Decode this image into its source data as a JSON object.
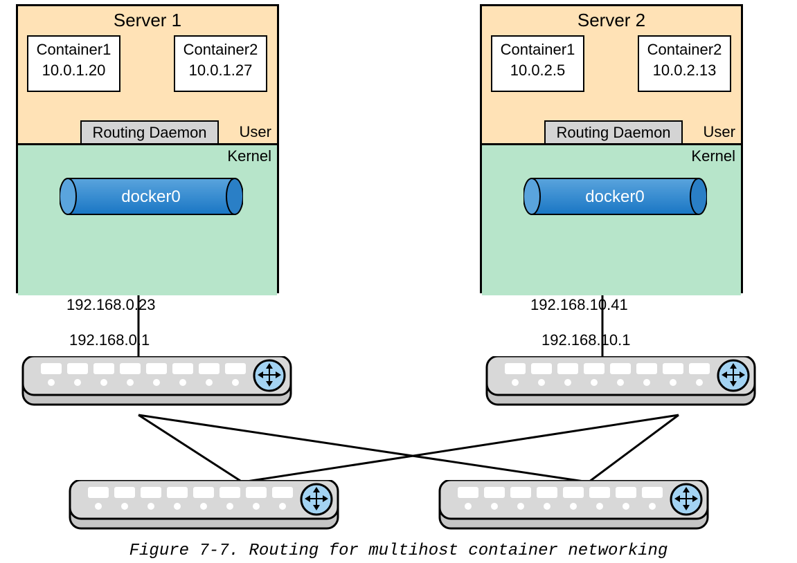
{
  "caption": "Figure 7-7. Routing for multihost container networking",
  "servers": [
    {
      "title": "Server 1",
      "user_label": "User",
      "kernel_label": "Kernel",
      "routing_daemon": "Routing Daemon",
      "docker_bridge": "docker0",
      "containers": [
        {
          "name": "Container1",
          "ip": "10.0.1.20"
        },
        {
          "name": "Container2",
          "ip": "10.0.1.27"
        }
      ],
      "host_ip": "192.168.0.23",
      "gateway_ip": "192.168.0.1"
    },
    {
      "title": "Server 2",
      "user_label": "User",
      "kernel_label": "Kernel",
      "routing_daemon": "Routing Daemon",
      "docker_bridge": "docker0",
      "containers": [
        {
          "name": "Container1",
          "ip": "10.0.2.5"
        },
        {
          "name": "Container2",
          "ip": "10.0.2.13"
        }
      ],
      "host_ip": "192.168.10.41",
      "gateway_ip": "192.168.10.1"
    }
  ]
}
